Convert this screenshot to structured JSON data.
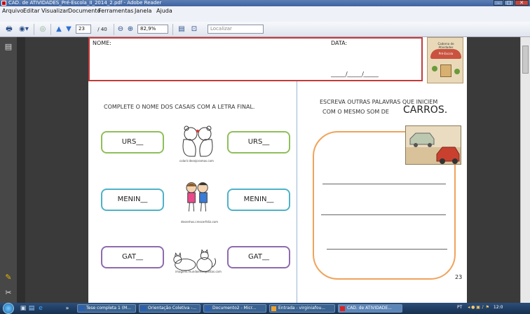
{
  "window": {
    "title": "CAD. de ATIVIDADES_Pré-Escola_II_2014_2.pdf - Adobe Reader",
    "min": "–",
    "max": "□",
    "close": "✕"
  },
  "menu": [
    "Arquivo",
    "Editar",
    "Visualizar",
    "Documento",
    "Ferramentas",
    "Janela",
    "Ajuda"
  ],
  "toolbar": {
    "page_current": "23",
    "page_total": "/ 40",
    "zoom": "82,9%",
    "search_placeholder": "Localizar"
  },
  "page": {
    "name_label": "NOME:",
    "date_label": "DATA:",
    "date_format": "______/______/______",
    "cover_title": "Caderno de Atividades",
    "cover_subtitle": "Pré-Escola",
    "left_instruction": "COMPLETE O NOME DOS CASAIS COM A LETRA FINAL.",
    "right_instruction_line1": "ESCREVA OUTRAS PALAVRAS QUE INICIEM",
    "right_instruction_line2": "COM O MESMO SOM DE",
    "right_instruction_word": "CARROS",
    "right_instruction_period": ".",
    "pairs": [
      {
        "left": "URS__",
        "right": "URS__",
        "caption": "colorir.desejoramos.com"
      },
      {
        "left": "MENIN__",
        "right": "MENIN__",
        "caption": "desenhos.crescerfeliz.com"
      },
      {
        "left": "GAT__",
        "right": "GAT__",
        "caption": "imagens.mundoentrepastas.com"
      }
    ],
    "page_number": "23"
  },
  "taskbar": {
    "items": [
      "Tese completa 1 (M...",
      "Orientação Coletiva -...",
      "Documento2 - Micr...",
      "Entrada - virginiafou...",
      "CAD. de ATIVIDADE..."
    ],
    "more": "»",
    "lang": "PT",
    "time": "12:0"
  }
}
